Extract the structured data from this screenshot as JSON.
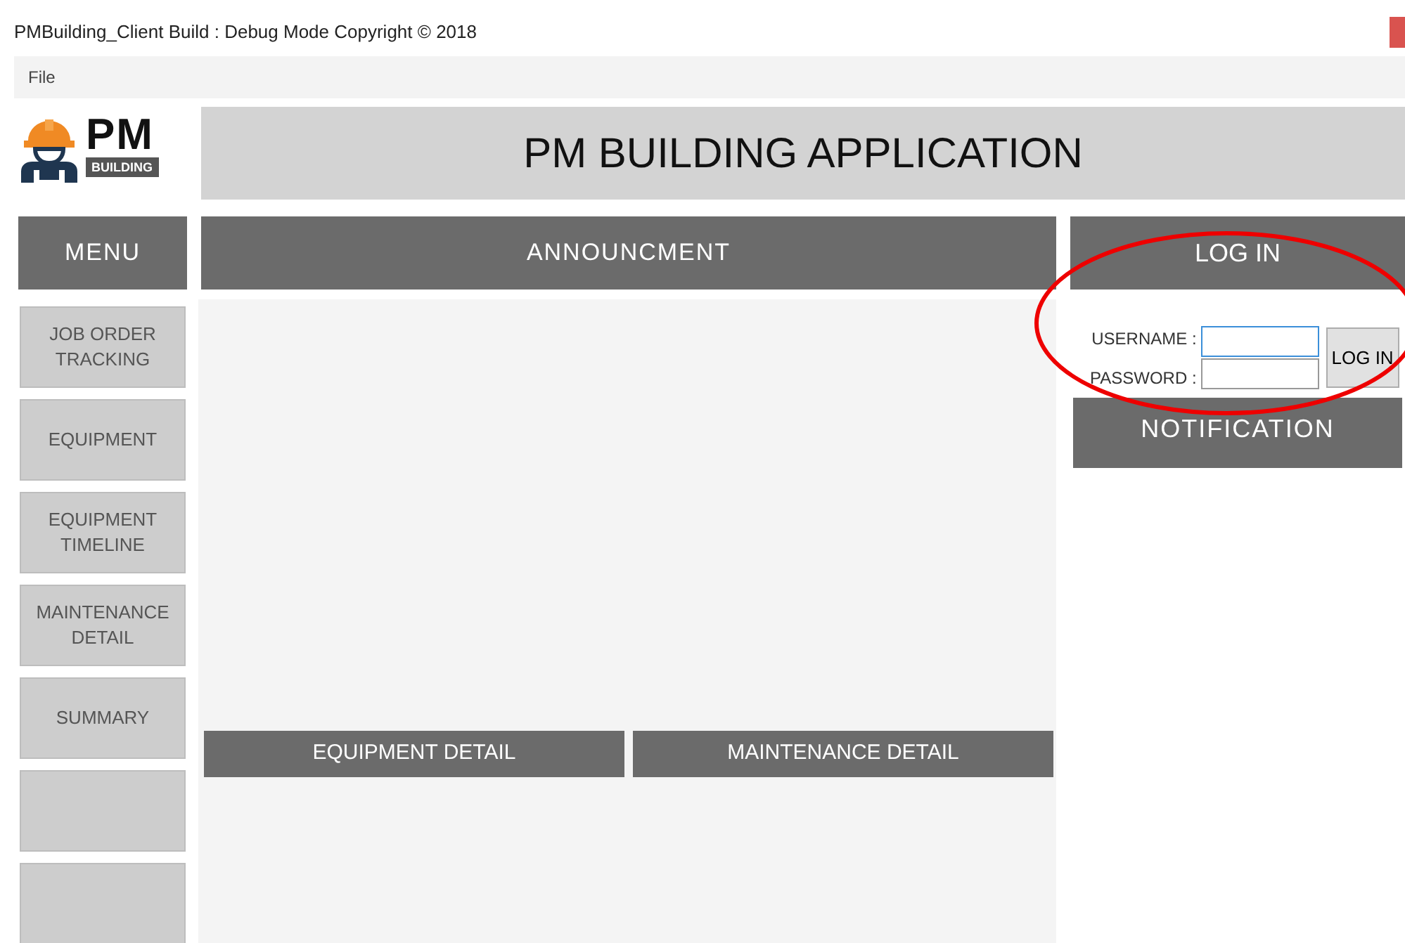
{
  "window": {
    "title": "PMBuilding_Client Build : Debug Mode  Copyright ©  2018"
  },
  "menu_bar": [
    "File"
  ],
  "logo": {
    "main": "PM",
    "sub": "BUILDING"
  },
  "app_title": "PM BUILDING APPLICATION",
  "menu": {
    "heading": "MENU",
    "items": [
      {
        "kind": "label",
        "label": "JOB ORDER TRACKING"
      },
      {
        "kind": "label",
        "label": "EQUIPMENT"
      },
      {
        "kind": "label",
        "label": "EQUIPMENT TIMELINE"
      },
      {
        "kind": "label",
        "label": "MAINTENANCE DETAIL"
      },
      {
        "kind": "label",
        "label": "SUMMARY"
      },
      {
        "kind": "blank"
      },
      {
        "kind": "blank"
      }
    ]
  },
  "announcement": {
    "heading": "ANNOUNCMENT",
    "tabs": [
      "EQUIPMENT DETAIL",
      "MAINTENANCE DETAIL"
    ]
  },
  "login": {
    "heading": "LOG IN",
    "username_label": "USERNAME :",
    "password_label": "PASSWORD :",
    "button": "LOG IN"
  },
  "notification": {
    "heading": "NOTIFICATION"
  }
}
